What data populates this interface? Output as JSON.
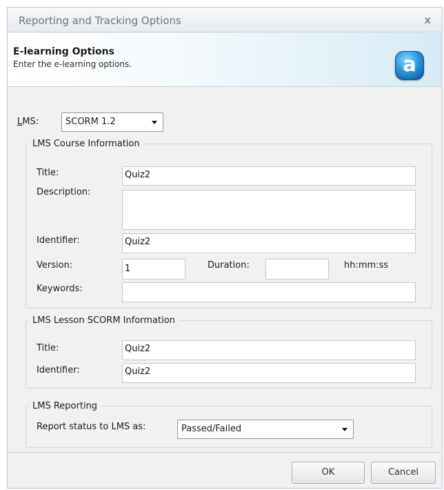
{
  "window": {
    "title": "Reporting and Tracking Options",
    "close_symbol": "x"
  },
  "header": {
    "title": "E-learning Options",
    "subtitle": "Enter the e-learning options.",
    "logo_letter": "a",
    "logo_icon": "app-logo-icon"
  },
  "lms": {
    "label": "LMS:",
    "selected": "SCORM 1.2"
  },
  "course_info": {
    "legend": "LMS Course Information",
    "title_label": "Title:",
    "title_value": "Quiz2",
    "description_label": "Description:",
    "description_value": "",
    "identifier_label": "Identifier:",
    "identifier_value": "Quiz2",
    "version_label": "Version:",
    "version_value": "1",
    "duration_label": "Duration:",
    "duration_value": "",
    "duration_format": "hh:mm:ss",
    "keywords_label": "Keywords:",
    "keywords_value": ""
  },
  "lesson_info": {
    "legend": "LMS Lesson SCORM Information",
    "title_label": "Title:",
    "title_value": "Quiz2",
    "identifier_label": "Identifier:",
    "identifier_value": "Quiz2"
  },
  "reporting": {
    "legend": "LMS Reporting",
    "status_label": "Report status to LMS as:",
    "status_selected": "Passed/Failed"
  },
  "buttons": {
    "ok": "OK",
    "cancel": "Cancel"
  }
}
